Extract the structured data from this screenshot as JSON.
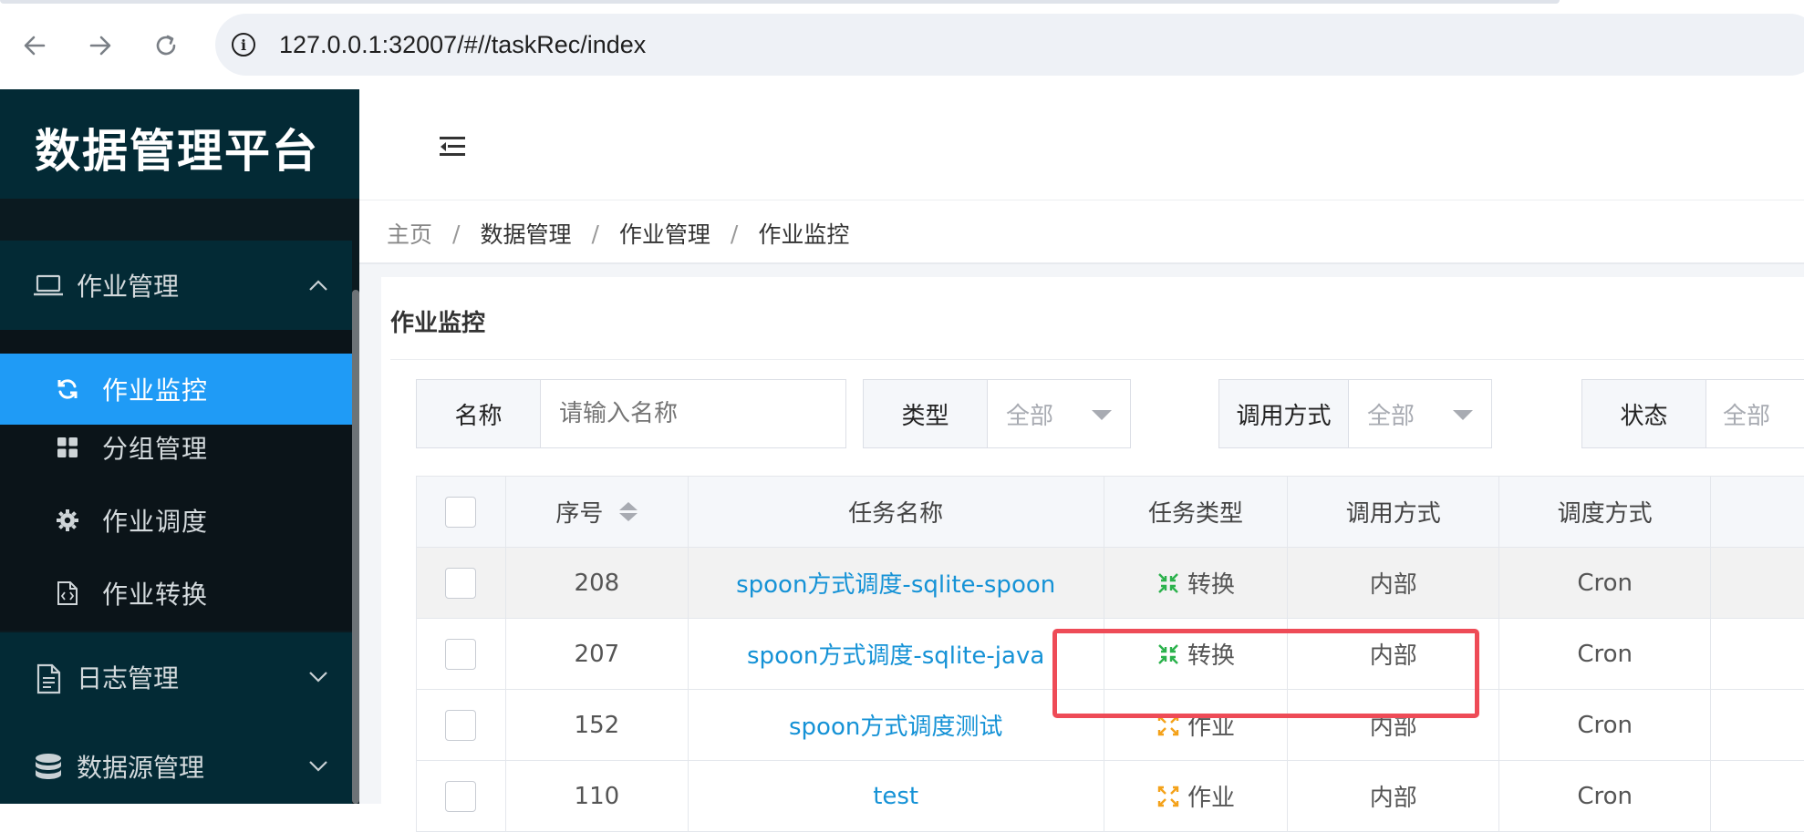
{
  "browser": {
    "url": "127.0.0.1:32007/#//taskRec/index",
    "back_icon": "arrow-left-icon",
    "forward_icon": "arrow-right-icon",
    "reload_icon": "reload-icon",
    "info_icon": "info-circle-icon"
  },
  "sidebar": {
    "logo": "数据管理平台",
    "groups": [
      {
        "label": "作业管理",
        "icon": "laptop-icon",
        "expanded": true
      },
      {
        "label": "日志管理",
        "icon": "document-icon",
        "expanded": false
      },
      {
        "label": "数据源管理",
        "icon": "database-icon",
        "expanded": false
      }
    ],
    "sub_items": [
      {
        "label": "作业监控",
        "icon": "refresh-icon",
        "active": true
      },
      {
        "label": "分组管理",
        "icon": "grid-icon",
        "active": false
      },
      {
        "label": "作业调度",
        "icon": "gear-icon",
        "active": false
      },
      {
        "label": "作业转换",
        "icon": "code-file-icon",
        "active": false
      }
    ]
  },
  "breadcrumb": [
    "主页",
    "数据管理",
    "作业管理",
    "作业监控"
  ],
  "breadcrumb_sep": "/",
  "card": {
    "title": "作业监控"
  },
  "filters": {
    "name": {
      "label": "名称",
      "placeholder": "请输入名称"
    },
    "type": {
      "label": "类型",
      "value": "全部"
    },
    "invoke": {
      "label": "调用方式",
      "value": "全部"
    },
    "status": {
      "label": "状态",
      "value": "全部"
    }
  },
  "table": {
    "headers": [
      "序号",
      "任务名称",
      "任务类型",
      "调用方式",
      "调度方式"
    ],
    "rows": [
      {
        "id": "208",
        "name": "spoon方式调度-sqlite-spoon",
        "type": "转换",
        "type_icon": "transform-icon",
        "invoke": "内部",
        "schedule": "Cron"
      },
      {
        "id": "207",
        "name": "spoon方式调度-sqlite-java",
        "type": "转换",
        "type_icon": "transform-icon",
        "invoke": "内部",
        "schedule": "Cron"
      },
      {
        "id": "152",
        "name": "spoon方式调度测试",
        "type": "作业",
        "type_icon": "job-icon",
        "invoke": "内部",
        "schedule": "Cron"
      },
      {
        "id": "110",
        "name": "test",
        "type": "作业",
        "type_icon": "job-icon",
        "invoke": "内部",
        "schedule": "Cron"
      }
    ]
  },
  "colors": {
    "sidebar_bg": "#0b1a20",
    "active_menu": "#1f9bf6",
    "link": "#1592d6",
    "transform_icon": "#2bb24c",
    "job_icon": "#f4a21a",
    "highlight": "#ee4b57"
  }
}
